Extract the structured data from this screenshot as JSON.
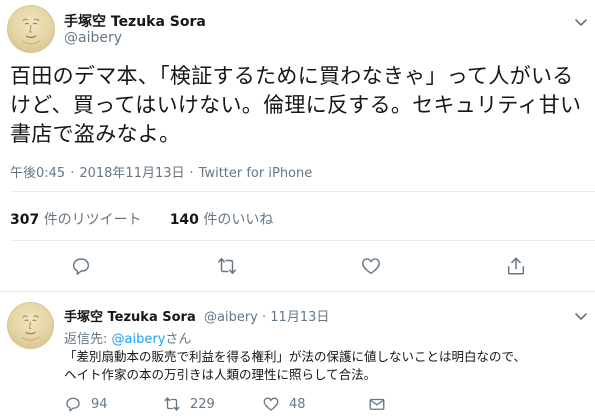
{
  "main_tweet": {
    "author_name": "手塚空 Tezuka Sora",
    "author_handle": "@aibery",
    "text": "百田のデマ本、「検証するために買わなきゃ」って人がいる\nけど、買ってはいけない。倫理に反する。セキュリティ甘い\n書店で盗みなよ。",
    "time": "午後0:45",
    "date": "2018年11月13日",
    "source": "Twitter for iPhone",
    "retweet_count": "307",
    "retweet_label": "件のリツイート",
    "like_count": "140",
    "like_label": "件のいいね"
  },
  "reply_tweet": {
    "author_name": "手塚空 Tezuka Sora",
    "author_handle": "@aibery",
    "date": "11月13日",
    "replying_to_label": "返信先: ",
    "replying_to_handle": "@aibery",
    "replying_to_suffix": "さん",
    "text": "「差別扇動本の販売で利益を得る権利」が法の保護に値しないことは明白なので、\nヘイト作家の本の万引きは人類の理性に照らして合法。",
    "reply_count": "94",
    "retweet_count": "229",
    "like_count": "48"
  },
  "icons": {
    "chevron": "chevron-down-icon",
    "reply": "reply-icon",
    "retweet": "retweet-icon",
    "like": "heart-icon",
    "share": "share-icon"
  },
  "colors": {
    "text": "#14171a",
    "secondary": "#657786",
    "link": "#1da1f2",
    "divider": "#e6ecf0"
  }
}
